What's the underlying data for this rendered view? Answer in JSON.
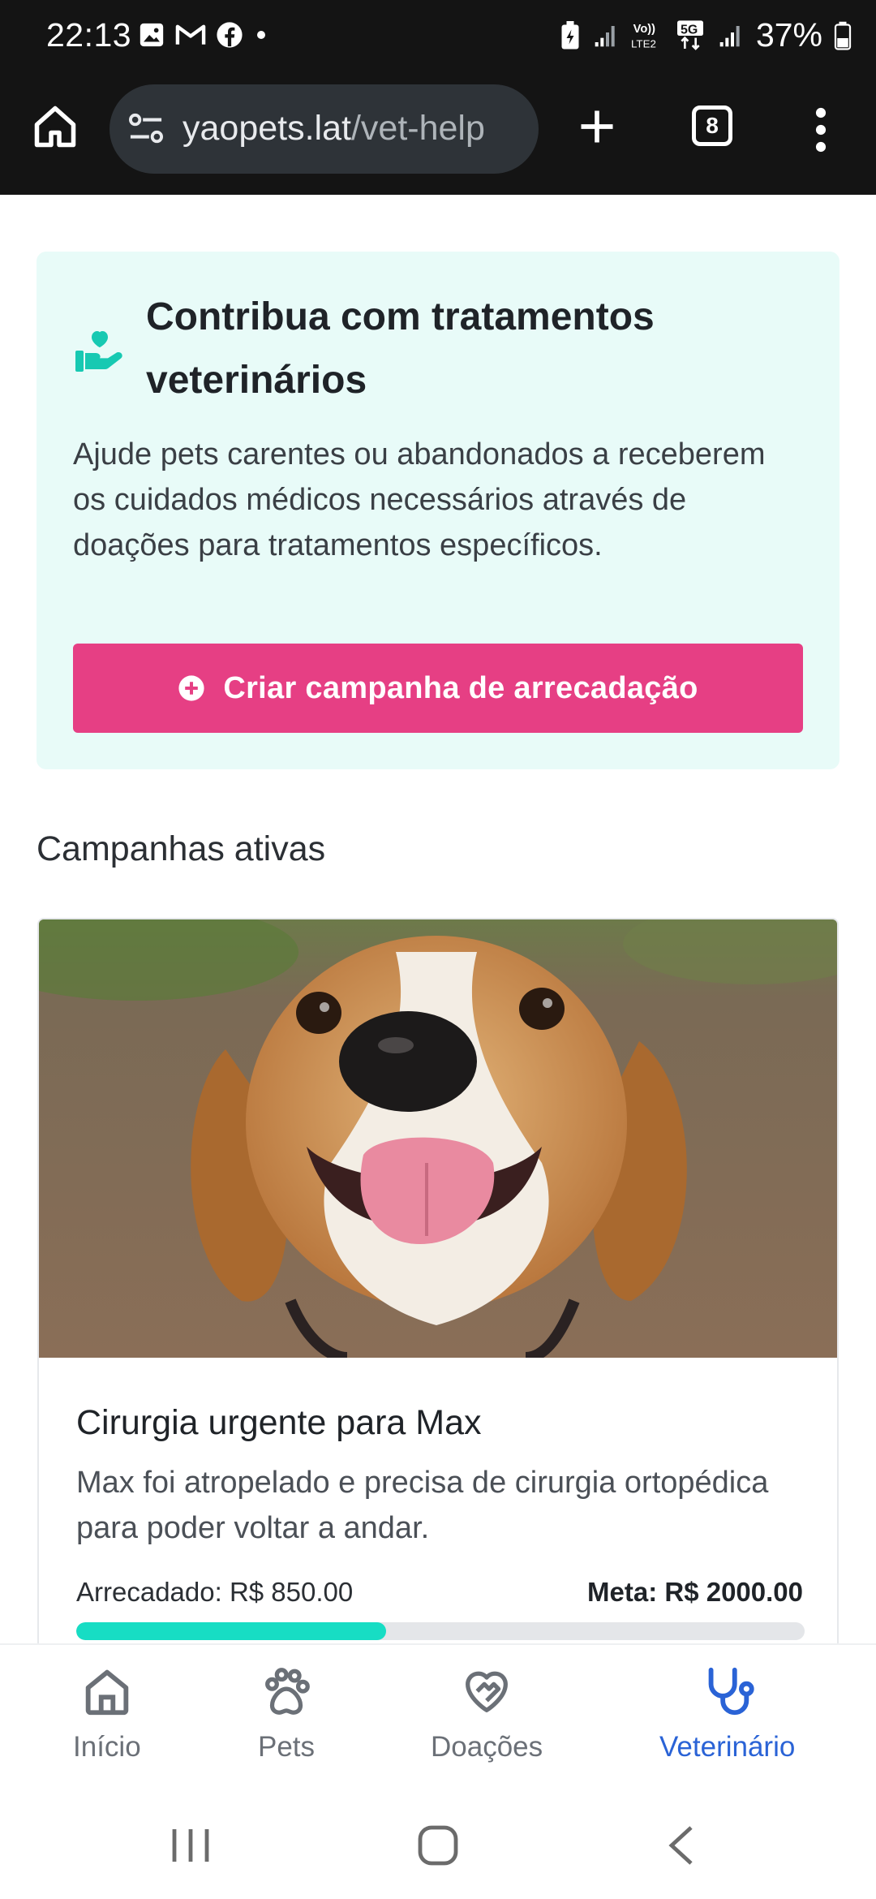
{
  "status_bar": {
    "time": "22:13",
    "battery": "37%",
    "network": "5G",
    "volte": "Vo)) LTE2",
    "icons": [
      "gallery-icon",
      "gmail-icon",
      "facebook-icon",
      "notification-dot-icon",
      "battery-saver-icon",
      "signal-icon",
      "volte-icon",
      "5g-icon",
      "signal-icon",
      "battery-icon"
    ]
  },
  "browser": {
    "url_host": "yaopets.lat",
    "url_path": "/vet-help",
    "tab_count": "8"
  },
  "hero": {
    "title": "Contribua com tratamentos veterinários",
    "description": "Ajude pets carentes ou abandonados a receberem os cuidados médicos necessários através de doações para tratamentos específicos.",
    "cta_label": "Criar campanha de arrecadação",
    "icon": "hand-heart-icon"
  },
  "campaigns_section": {
    "heading": "Campanhas ativas"
  },
  "campaigns": [
    {
      "title": "Cirurgia urgente para Max",
      "description": "Max foi atropelado e precisa de cirurgia ortopédica para poder voltar a andar.",
      "raised_label": "Arrecadado: R$ 850.00",
      "goal_label": "Meta: R$ 2000.00",
      "raised": 850,
      "goal": 2000,
      "image": "beagle-dog-photo"
    }
  ],
  "bottom_nav": {
    "items": [
      {
        "label": "Início",
        "icon": "home-icon"
      },
      {
        "label": "Pets",
        "icon": "paw-icon"
      },
      {
        "label": "Doações",
        "icon": "heart-handshake-icon"
      },
      {
        "label": "Veterinário",
        "icon": "stethoscope-icon",
        "active": true
      }
    ]
  },
  "colors": {
    "accent_pink": "#e63f84",
    "accent_teal": "#17ddc4",
    "hero_bg": "#e8fbf8",
    "active_nav": "#2a63d6"
  }
}
